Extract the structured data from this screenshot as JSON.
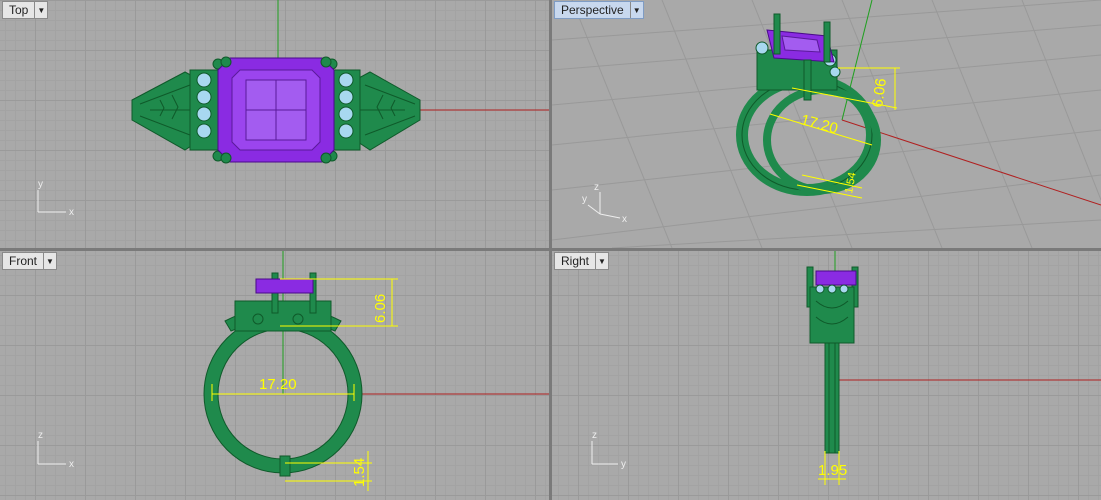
{
  "viewports": {
    "top": {
      "label": "Top",
      "axis_x": "x",
      "axis_y": "y"
    },
    "perspective": {
      "label": "Perspective",
      "axis_x": "x",
      "axis_y": "y",
      "axis_z": "z",
      "dim_height": "6.06",
      "dim_width": "17.20",
      "dim_band": "1.54"
    },
    "front": {
      "label": "Front",
      "axis_x": "x",
      "axis_y": "z",
      "dim_height": "6.06",
      "dim_width": "17.20",
      "dim_band": "1.54"
    },
    "right": {
      "label": "Right",
      "axis_x": "y",
      "axis_y": "z",
      "dim_band": "1.95"
    }
  },
  "colors": {
    "ring_metal": "#1f8a4c",
    "gem": "#8a2be2",
    "side_stones": "#a8d8f0",
    "x_axis": "#b02020",
    "y_axis": "#20a020",
    "dimension": "#ffff00"
  },
  "icons": {
    "viewport_menu": "triangle-down-icon"
  }
}
